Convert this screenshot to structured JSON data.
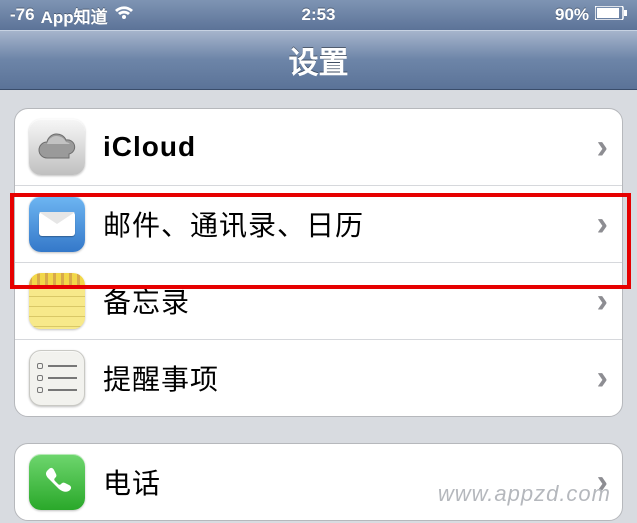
{
  "statusbar": {
    "signal": "-76",
    "carrier": "App知道",
    "time": "2:53",
    "battery": "90%"
  },
  "navbar": {
    "title": "设置"
  },
  "rows": {
    "icloud": {
      "label": "iCloud"
    },
    "mail": {
      "label": "邮件、通讯录、日历"
    },
    "notes": {
      "label": "备忘录"
    },
    "reminders": {
      "label": "提醒事项"
    },
    "phone": {
      "label": "电话"
    }
  },
  "watermark": "www.appzd.com"
}
